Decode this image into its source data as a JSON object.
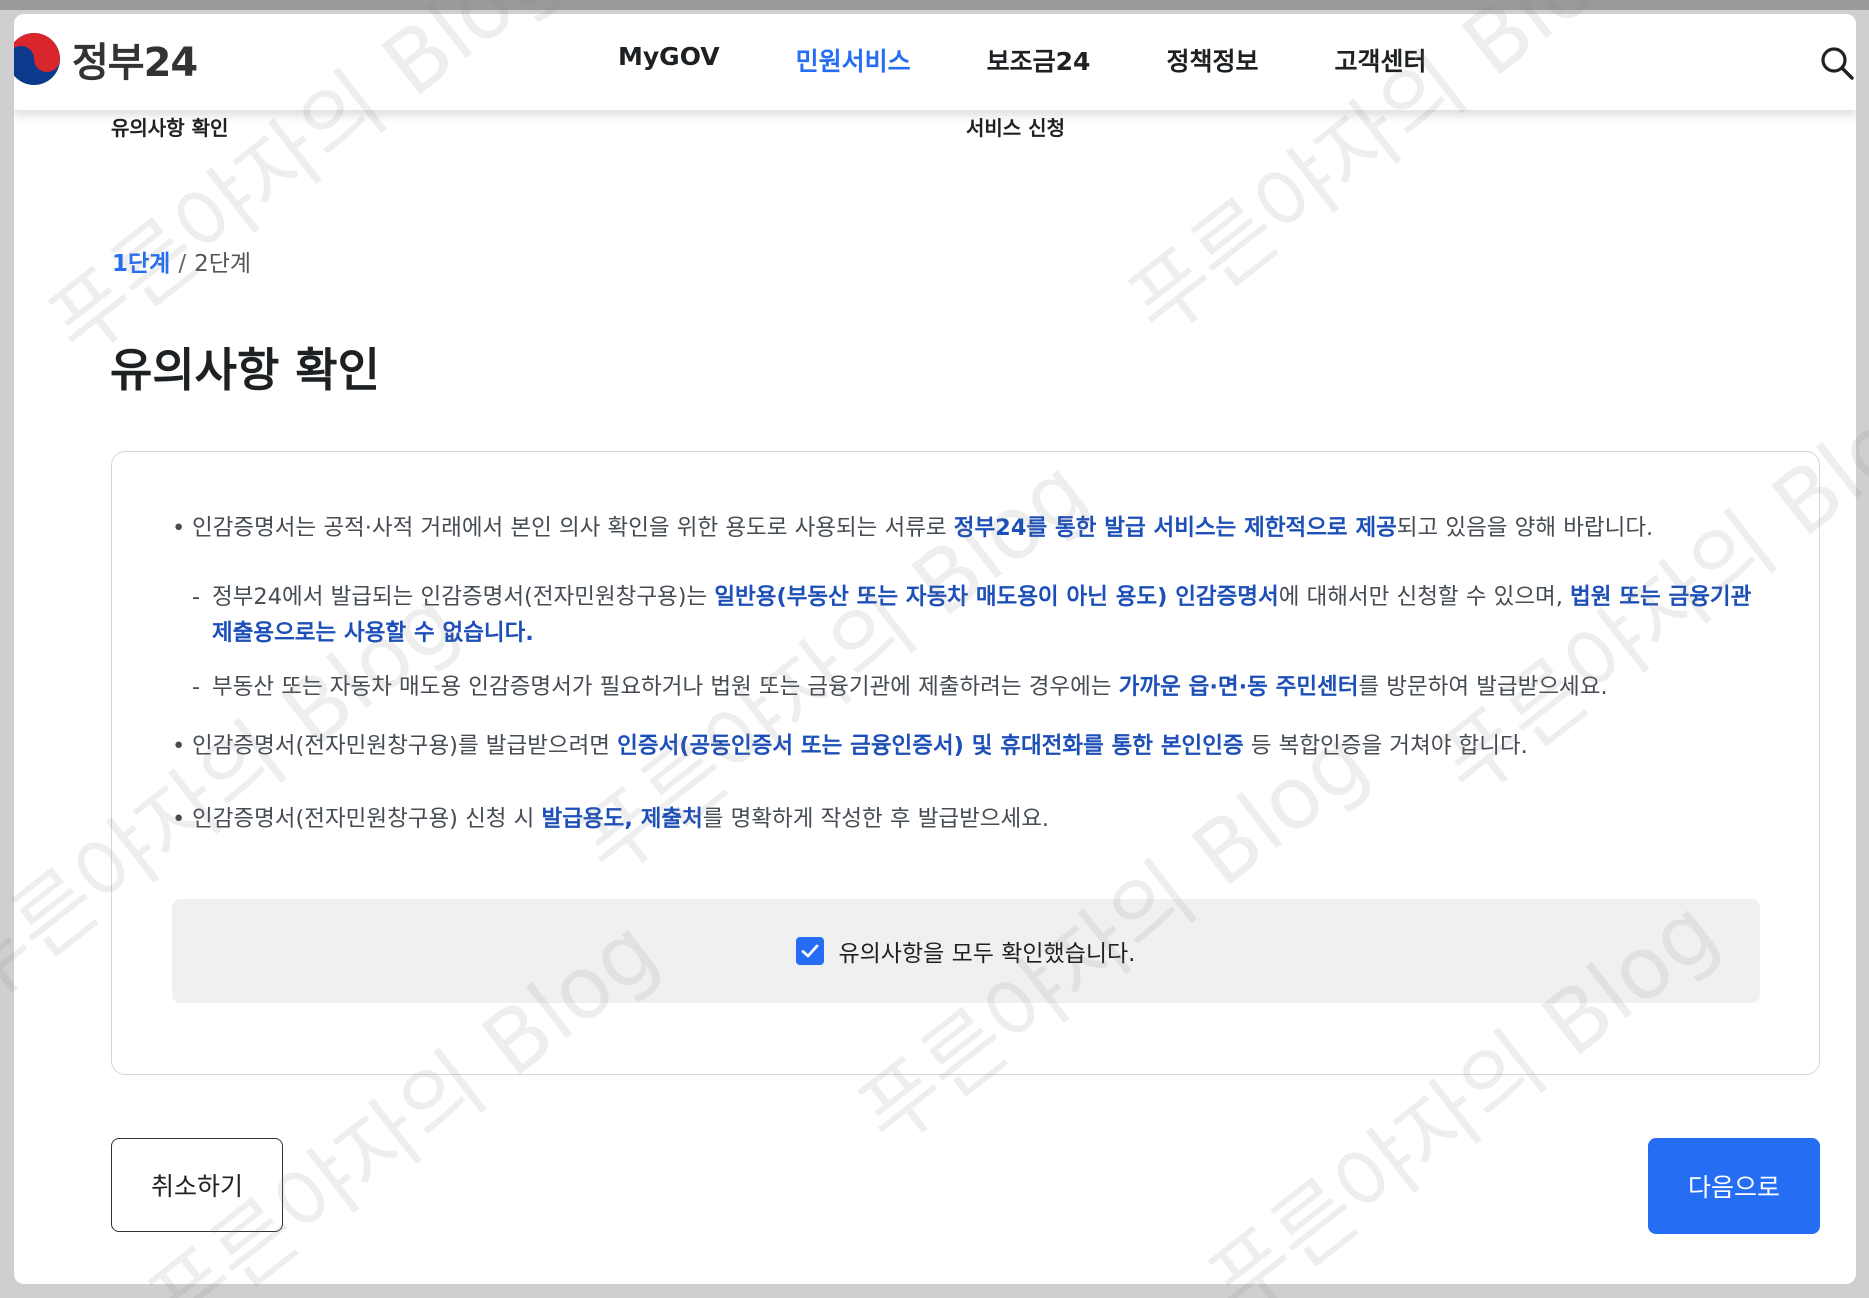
{
  "header": {
    "logo_text": "정부24",
    "nav": [
      {
        "label": "MyGOV"
      },
      {
        "label": "민원서비스"
      },
      {
        "label": "보조금24"
      },
      {
        "label": "정책정보"
      },
      {
        "label": "고객센터"
      }
    ],
    "active_nav": "민원서비스"
  },
  "sublabels": {
    "left": "유의사항 확인",
    "right": "서비스 신청"
  },
  "steps": {
    "current": "1단계",
    "separator": "/",
    "next": "2단계"
  },
  "page_title": "유의사항 확인",
  "notices": {
    "n1": {
      "a": "인감증명서는 공적·사적 거래에서 본인 의사 확인을 위한 용도로 사용되는 서류로 ",
      "b": "정부24를 통한 발급 서비스는 제한적으로 제공",
      "c": "되고 있음을 양해 바랍니다."
    },
    "s1": {
      "a": "정부24에서 발급되는 인감증명서(전자민원창구용)는 ",
      "b": "일반용(부동산 또는 자동차 매도용이 아닌 용도) 인감증명서",
      "c": "에 대해서만 신청할 수 있으며, ",
      "d": "법원 또는 금융기관 제출용으로는 사용할 수 없습니다."
    },
    "s2": {
      "a": "부동산 또는 자동차 매도용 인감증명서가 필요하거나 법원 또는 금융기관에 제출하려는 경우에는 ",
      "b": "가까운 읍·면·동 주민센터",
      "c": "를 방문하여 발급받으세요."
    },
    "n2": {
      "a": "인감증명서(전자민원창구용)를 발급받으려면 ",
      "b": "인증서(공동인증서 또는 금융인증서) 및 휴대전화를 통한 본인인증",
      "c": " 등 복합인증을 거쳐야 합니다."
    },
    "n3": {
      "a": "인감증명서(전자민원창구용) 신청 시 ",
      "b": "발급용도, 제출처",
      "c": "를 명확하게 작성한 후 발급받으세요."
    }
  },
  "confirm": {
    "label": "유의사항을 모두 확인했습니다.",
    "checked": true
  },
  "buttons": {
    "cancel": "취소하기",
    "next": "다음으로"
  },
  "watermark_text": "푸른야자의 Blog",
  "colors": {
    "accent": "#256ef4",
    "emphasis": "#1d4fb8",
    "confirm_bg": "#f0f0f0"
  },
  "icons": {
    "search": "search-icon",
    "check": "check-icon",
    "logo": "taegeuk-logo-icon"
  }
}
